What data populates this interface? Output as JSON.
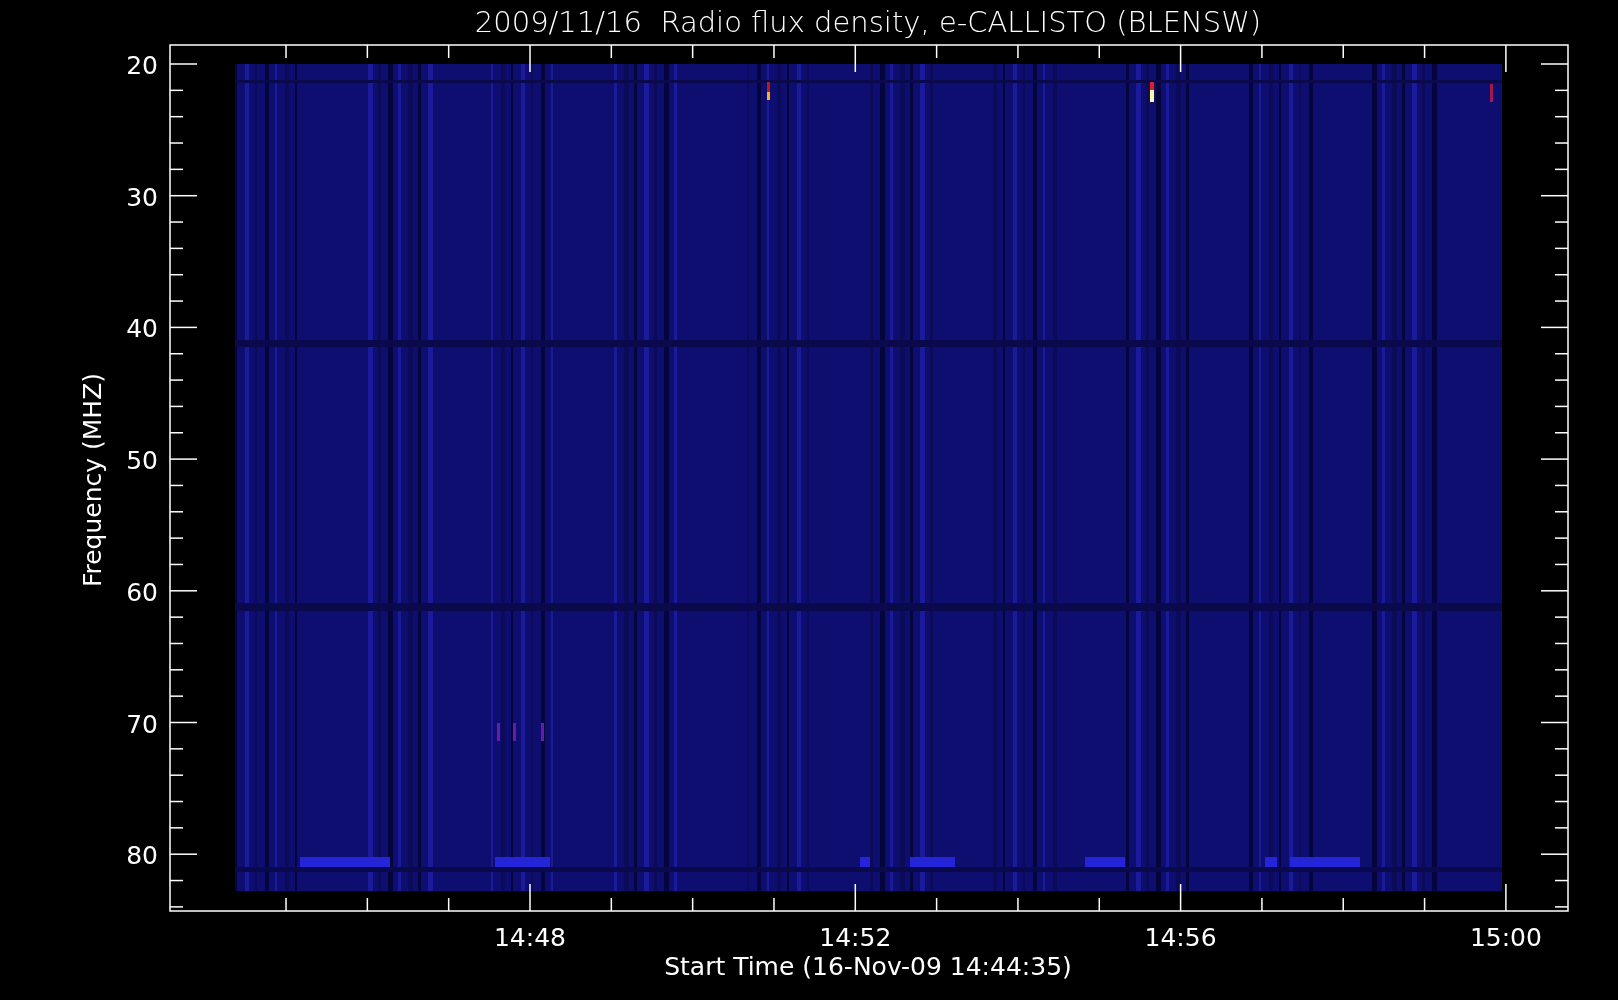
{
  "plot": {
    "title": "2009/11/16  Radio flux density, e-CALLISTO (BLENSW)",
    "y_axis": {
      "label": "Frequency (MHZ)",
      "ticks": [
        "20",
        "30",
        "40",
        "50",
        "60",
        "70",
        "80"
      ]
    },
    "x_axis": {
      "label": "Start Time (16-Nov-09 14:44:35)",
      "ticks": [
        "14:48",
        "14:52",
        "14:56",
        "15:00"
      ]
    }
  }
}
